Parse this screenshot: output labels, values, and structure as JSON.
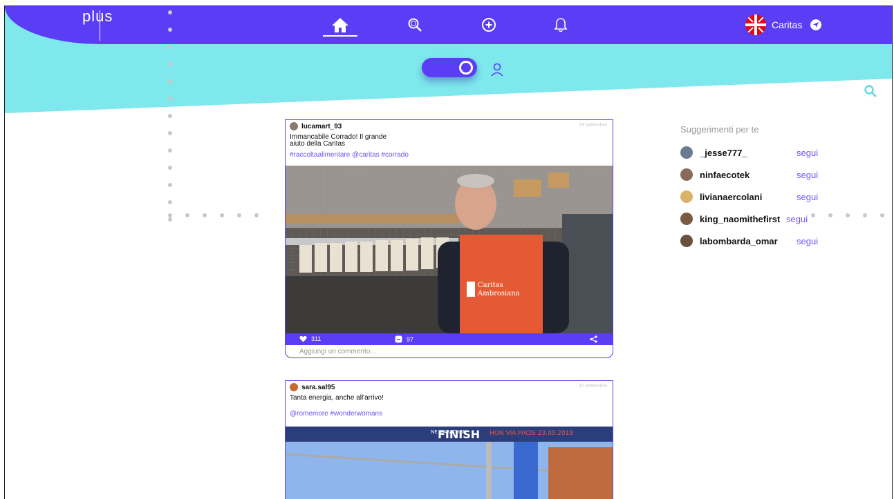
{
  "header": {
    "logo_text": "plus",
    "nav": [
      {
        "icon": "home-icon",
        "active": true
      },
      {
        "icon": "search-icon"
      },
      {
        "icon": "add-circle-icon"
      },
      {
        "icon": "bell-icon"
      }
    ],
    "account_name": "Caritas"
  },
  "colors": {
    "primary": "#5b3df5",
    "accent": "#7ee8ec",
    "link": "#6a55f0"
  },
  "posts": [
    {
      "user": "lucamart_93",
      "date": "29 settembre",
      "caption": "Immancabile Corrado! Il grande\naiuto della Caritas",
      "tags": "#raccoltaalimentare @caritas #corrado",
      "image_text": "Caritas\nAmbrosiana",
      "likes": "311",
      "comments": "97",
      "comment_placeholder": "Aggiungi un commento..."
    },
    {
      "user": "sara.sal95",
      "date": "10 settembre",
      "caption": "Tanta energia, anche all'arrivo!",
      "tags": "@romemore #wonderwomans",
      "banner_text": "FINISH",
      "banner_sub": "HON VIA PACIS 23.09.2018",
      "banner_left": "NE MARATHON"
    }
  ],
  "suggestions": {
    "title": "Suggerimenti per te",
    "follow_label": "segui",
    "users": [
      "_jesse777_",
      "ninfaecotek",
      "livianaercolani",
      "king_naomithefirst",
      "labombarda_omar"
    ]
  }
}
